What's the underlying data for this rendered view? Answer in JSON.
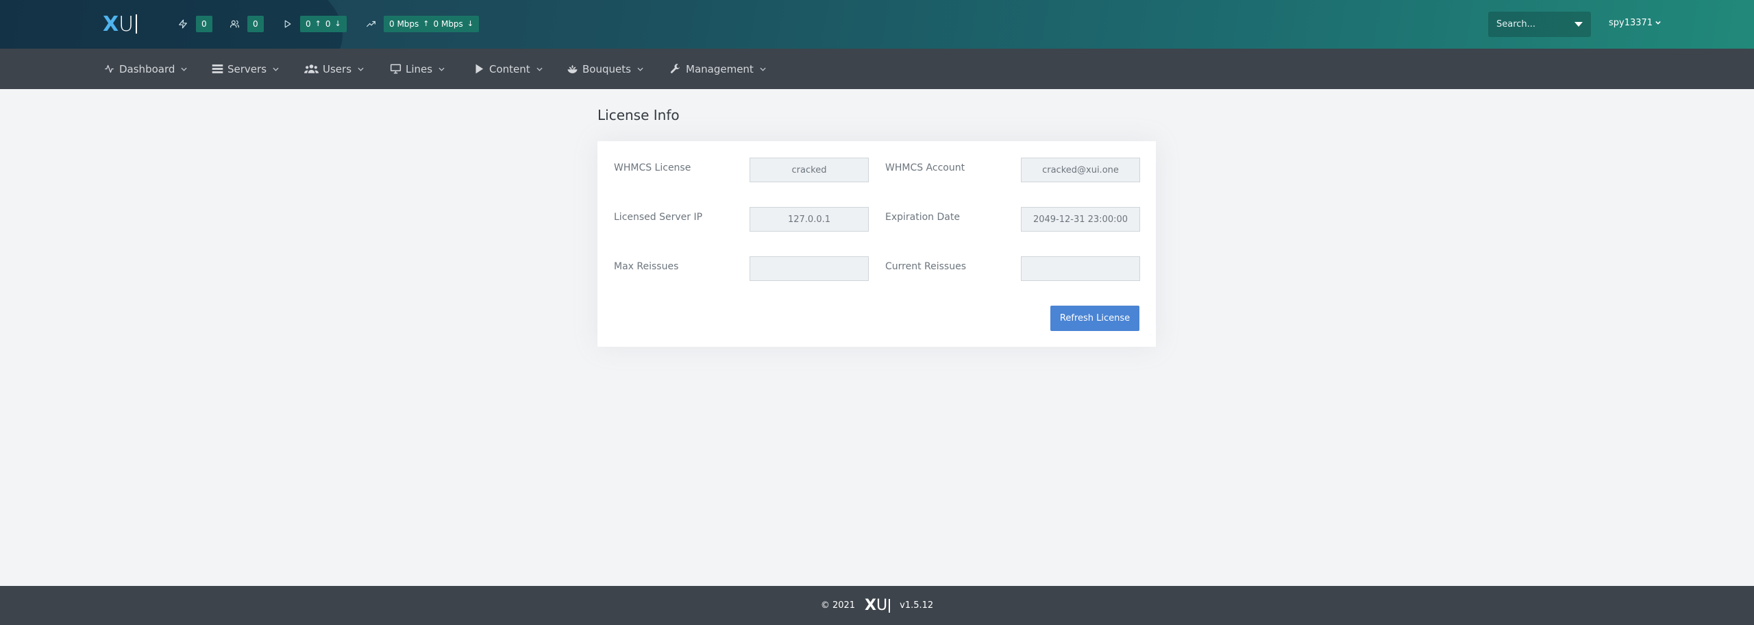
{
  "header": {
    "logo_letter_x": "X",
    "logo_letter_u": "U",
    "stats": [
      {
        "icon": "bolt-icon",
        "values": [
          "0"
        ]
      },
      {
        "icon": "users-icon",
        "values": [
          "0"
        ]
      },
      {
        "icon": "play-icon",
        "values": [
          "0",
          "0"
        ],
        "arrows": [
          "↑",
          "↓"
        ]
      },
      {
        "icon": "trend-up-icon",
        "values": [
          "0 Mbps",
          "0 Mbps"
        ],
        "arrows": [
          "↑",
          "↓"
        ]
      }
    ],
    "search_placeholder": "Search...",
    "username": "spy13371"
  },
  "nav": {
    "items": [
      {
        "label": "Dashboard",
        "icon": "activity-icon"
      },
      {
        "label": "Servers",
        "icon": "server-icon"
      },
      {
        "label": "Users",
        "icon": "users-icon"
      },
      {
        "label": "Lines",
        "icon": "monitor-icon"
      },
      {
        "label": "Content",
        "icon": "play-icon"
      },
      {
        "label": "Bouquets",
        "icon": "bouquet-icon"
      },
      {
        "label": "Management",
        "icon": "wrench-icon"
      }
    ]
  },
  "page": {
    "title": "License Info"
  },
  "license": {
    "whmcs_license_label": "WHMCS License",
    "whmcs_license_value": "cracked",
    "whmcs_account_label": "WHMCS Account",
    "whmcs_account_value": "cracked@xui.one",
    "server_ip_label": "Licensed Server IP",
    "server_ip_value": "127.0.0.1",
    "expiration_label": "Expiration Date",
    "expiration_value": "2049-12-31 23:00:00",
    "max_reissues_label": "Max Reissues",
    "max_reissues_value": "",
    "current_reissues_label": "Current Reissues",
    "current_reissues_value": "",
    "refresh_button": "Refresh License"
  },
  "footer": {
    "copyright": "© 2021",
    "version": "v1.5.12"
  },
  "colors": {
    "accent": "#4a84d4",
    "chip": "#1a7466",
    "navbar": "#3d444c"
  }
}
